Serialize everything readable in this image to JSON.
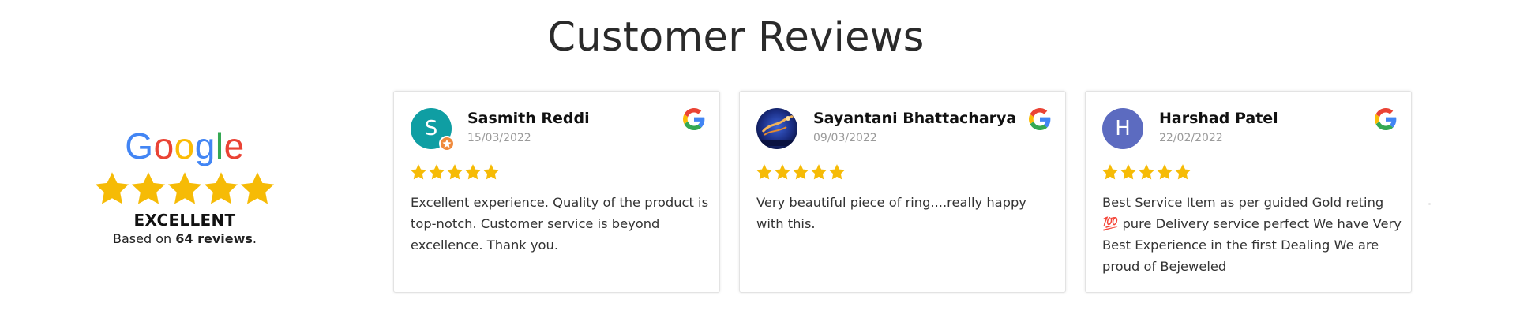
{
  "page": {
    "title": "Customer Reviews"
  },
  "summary": {
    "brand": {
      "letters": [
        "G",
        "o",
        "o",
        "g",
        "l",
        "e"
      ],
      "colors": [
        "#4285F4",
        "#EA4335",
        "#FBBC05",
        "#4285F4",
        "#34A853",
        "#EA4335"
      ]
    },
    "stars": 5,
    "rating_label": "EXCELLENT",
    "based_on_prefix": "Based on ",
    "review_count": "64 reviews",
    "based_on_suffix": ".",
    "star_color": "#F6BB06"
  },
  "reviews": [
    {
      "name": "Sasmith Reddi",
      "date": "15/03/2022",
      "rating": 5,
      "text": "Excellent experience. Quality of the product is top-notch. Customer service is beyond excellence. Thank you.",
      "avatar": {
        "type": "initial",
        "letter": "S",
        "color": "#0F9EA3",
        "badge": "star-badge-icon"
      },
      "source_icon": "google-g-icon"
    },
    {
      "name": "Sayantani Bhattacharya",
      "date": "09/03/2022",
      "rating": 5,
      "text": "Very beautiful piece of ring....really happy with this.",
      "avatar": {
        "type": "photo"
      },
      "source_icon": "google-g-icon"
    },
    {
      "name": "Harshad Patel",
      "date": "22/02/2022",
      "rating": 5,
      "text": "Best Service Item as per guided Gold reting 💯 pure Delivery service perfect We have Very Best Experience in the first Dealing We are proud of Bejeweled",
      "avatar": {
        "type": "initial",
        "letter": "H",
        "color": "#5C6BC0"
      },
      "source_icon": "google-g-icon"
    }
  ]
}
